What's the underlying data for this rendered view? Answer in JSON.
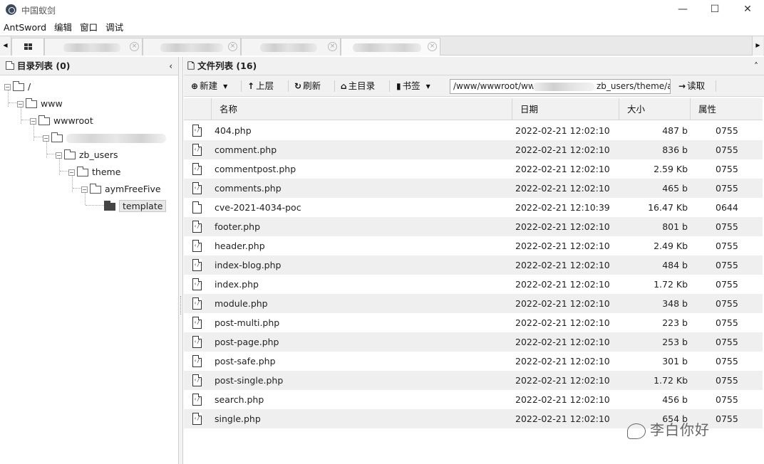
{
  "window": {
    "title": "中国蚁剑",
    "minimize": "—",
    "maximize": "☐",
    "close": "✕"
  },
  "menu": [
    "AntSword",
    "编辑",
    "窗口",
    "调试"
  ],
  "tabs": {
    "close_glyph": "×",
    "left_arrow": "◀",
    "right_arrow": "▶"
  },
  "dir_panel": {
    "title": "目录列表 (0)",
    "collapse_glyph": "‹"
  },
  "tree": {
    "root": "/",
    "www": "www",
    "wwwroot": "wwwroot",
    "zb_users": "zb_users",
    "theme": "theme",
    "aymFreeFive": "aymFreeFive",
    "template": "template"
  },
  "file_panel": {
    "title": "文件列表 (16)",
    "collapse_glyph": "˄"
  },
  "toolbar": {
    "new": "新建",
    "up": "上层",
    "refresh": "刷新",
    "home": "主目录",
    "bookmark": "书签",
    "path": "/www/wwwroot/www",
    "path_tail": "zb_users/theme/ay",
    "read": "读取"
  },
  "columns": {
    "name": "名称",
    "date": "日期",
    "size": "大小",
    "perm": "属性"
  },
  "files": [
    {
      "name": "404.php",
      "date": "2022-02-21 12:02:10",
      "size": "487 b",
      "perm": "0755",
      "php": true
    },
    {
      "name": "comment.php",
      "date": "2022-02-21 12:02:10",
      "size": "836 b",
      "perm": "0755",
      "php": true
    },
    {
      "name": "commentpost.php",
      "date": "2022-02-21 12:02:10",
      "size": "2.59 Kb",
      "perm": "0755",
      "php": true
    },
    {
      "name": "comments.php",
      "date": "2022-02-21 12:02:10",
      "size": "465 b",
      "perm": "0755",
      "php": true
    },
    {
      "name": "cve-2021-4034-poc",
      "date": "2022-02-21 12:10:39",
      "size": "16.47 Kb",
      "perm": "0644",
      "php": false
    },
    {
      "name": "footer.php",
      "date": "2022-02-21 12:02:10",
      "size": "801 b",
      "perm": "0755",
      "php": true
    },
    {
      "name": "header.php",
      "date": "2022-02-21 12:02:10",
      "size": "2.49 Kb",
      "perm": "0755",
      "php": true
    },
    {
      "name": "index-blog.php",
      "date": "2022-02-21 12:02:10",
      "size": "484 b",
      "perm": "0755",
      "php": true
    },
    {
      "name": "index.php",
      "date": "2022-02-21 12:02:10",
      "size": "1.72 Kb",
      "perm": "0755",
      "php": true
    },
    {
      "name": "module.php",
      "date": "2022-02-21 12:02:10",
      "size": "348 b",
      "perm": "0755",
      "php": true
    },
    {
      "name": "post-multi.php",
      "date": "2022-02-21 12:02:10",
      "size": "223 b",
      "perm": "0755",
      "php": true
    },
    {
      "name": "post-page.php",
      "date": "2022-02-21 12:02:10",
      "size": "253 b",
      "perm": "0755",
      "php": true
    },
    {
      "name": "post-safe.php",
      "date": "2022-02-21 12:02:10",
      "size": "301 b",
      "perm": "0755",
      "php": true
    },
    {
      "name": "post-single.php",
      "date": "2022-02-21 12:02:10",
      "size": "1.72 Kb",
      "perm": "0755",
      "php": true
    },
    {
      "name": "search.php",
      "date": "2022-02-21 12:02:10",
      "size": "456 b",
      "perm": "0755",
      "php": true
    },
    {
      "name": "single.php",
      "date": "2022-02-21 12:02:10",
      "size": "654 b",
      "perm": "0755",
      "php": true
    }
  ],
  "watermark": "李白你好"
}
